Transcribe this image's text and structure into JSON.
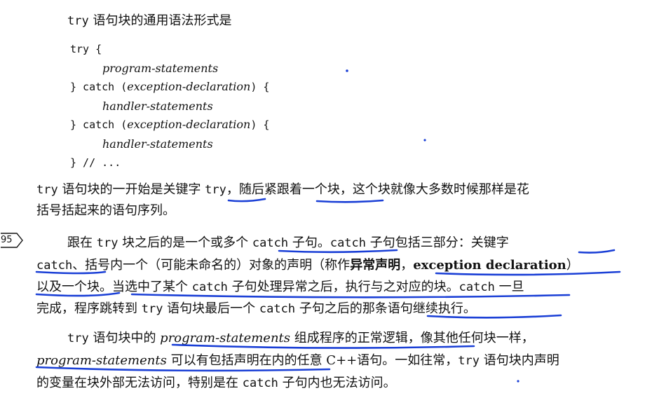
{
  "intro": {
    "kw": "try",
    "text": " 语句块的通用语法形式是"
  },
  "code_block": {
    "l1": "try {",
    "l2": "program-statements",
    "l3_a": "} catch (",
    "l3_b": "exception-declaration",
    "l3_c": ") {",
    "l4": "handler-statements",
    "l5_a": "} catch (",
    "l5_b": "exception-declaration",
    "l5_c": ") {",
    "l6": "handler-statements",
    "l7": "} // ..."
  },
  "para1": {
    "l1_a": "try",
    "l1_b": " 语句块的一开始是关键字 ",
    "l1_c": "try",
    "l1_d": "，随后紧跟着一个块，这个块就像大多数时候那样是花",
    "l2": "括号括起来的语句序列。"
  },
  "margin_page": "95",
  "para2": {
    "l1_a": "跟在 ",
    "l1_b": "try",
    "l1_c": " 块之后的是一个或多个 ",
    "l1_d": "catch",
    "l1_e": " 子句。",
    "l1_f": "catch",
    "l1_g": " 子句包括三部分：关键字",
    "l2_a": "catch",
    "l2_b": "、括号内一个（可能未命名的）对象的声明（称作",
    "l2_c": "异常声明",
    "l2_d": "，",
    "l2_e": "exception declaration",
    "l2_f": "）",
    "l3_a": "以及一个块。当选中了某个 ",
    "l3_b": "catch",
    "l3_c": " 子句处理异常之后，执行与之对应的块。",
    "l3_d": "catch",
    "l3_e": " 一旦",
    "l4_a": "完成，程序跳转到 ",
    "l4_b": "try",
    "l4_c": " 语句块最后一个 ",
    "l4_d": "catch",
    "l4_e": " 子句之后的那条语句继续执行。"
  },
  "para3": {
    "l1_a": "try",
    "l1_b": " 语句块中的 ",
    "l1_c": "program-statements",
    "l1_d": " 组成程序的正常逻辑，像其他任何块一样，",
    "l2_a": "program-statements",
    "l2_b": " 可以有包括声明在内的任意 C++语句。一如往常，",
    "l2_c": "try",
    "l2_d": " 语句块内声明",
    "l3_a": "的变量在块外部无法访问，特别是在 ",
    "l3_b": "catch",
    "l3_c": " 子句内也无法访问。"
  },
  "annotation_color": "#1a3fd6"
}
